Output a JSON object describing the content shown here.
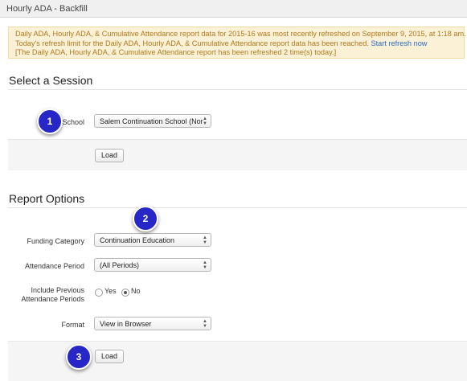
{
  "window": {
    "title": "Hourly ADA - Backfill"
  },
  "alert": {
    "line1": "Daily ADA, Hourly ADA, & Cumulative Attendance report data for 2015-16 was most recently refreshed on September 9, 2015, at 1:18 am.",
    "line2_text": "Today's refresh limit for the Daily ADA, Hourly ADA, & Cumulative Attendance report data has been reached.",
    "line2_link": "Start refresh now",
    "line3": "[The Daily ADA, Hourly ADA, & Cumulative Attendance report has been refreshed 2 time(s) today.]"
  },
  "session": {
    "title": "Select a Session",
    "school_label": "School",
    "school_value": "Salem Continuation School (Nor",
    "load_label": "Load"
  },
  "report": {
    "title": "Report Options",
    "funding_label": "Funding Category",
    "funding_value": "Continuation Education",
    "period_label": "Attendance Period",
    "period_value": "(All Periods)",
    "include_label_1": "Include Previous",
    "include_label_2": "Attendance Periods",
    "include_yes": "Yes",
    "include_no": "No",
    "include_selected": "No",
    "format_label": "Format",
    "format_value": "View in Browser",
    "load_label": "Load"
  },
  "badges": [
    "1",
    "2",
    "3"
  ]
}
